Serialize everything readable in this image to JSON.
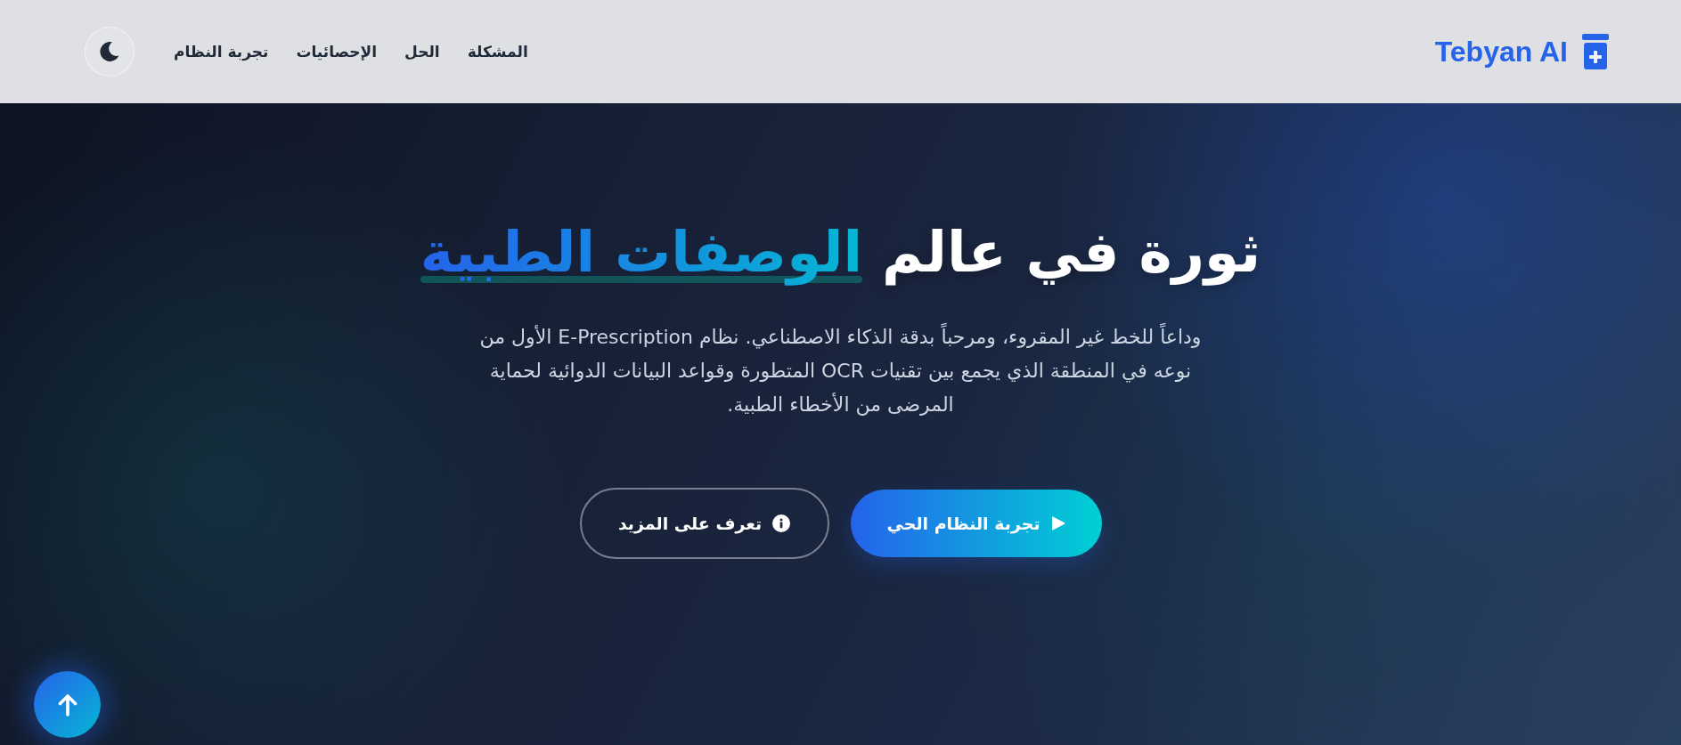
{
  "header": {
    "logo": "Tebyan AI",
    "nav": [
      "المشكلة",
      "الحل",
      "الإحصائيات",
      "تجربة النظام"
    ]
  },
  "hero": {
    "title": "ثورة في عالم",
    "title_highlight": "الوصفات الطبية",
    "description": "وداعاً للخط غير المقروء، ومرحباً بدقة الذكاء الاصطناعي. نظام E-Prescription الأول من نوعه في المنطقة الذي يجمع بين تقنيات OCR المتطورة وقواعد البيانات الدوائية لحماية المرضى من الأخطاء الطبية.",
    "buttons": [
      {
        "kind": "primary",
        "label": "تجربة النظام الحي"
      },
      {
        "kind": "outline",
        "label": "تعرف على المزيد"
      }
    ]
  }
}
